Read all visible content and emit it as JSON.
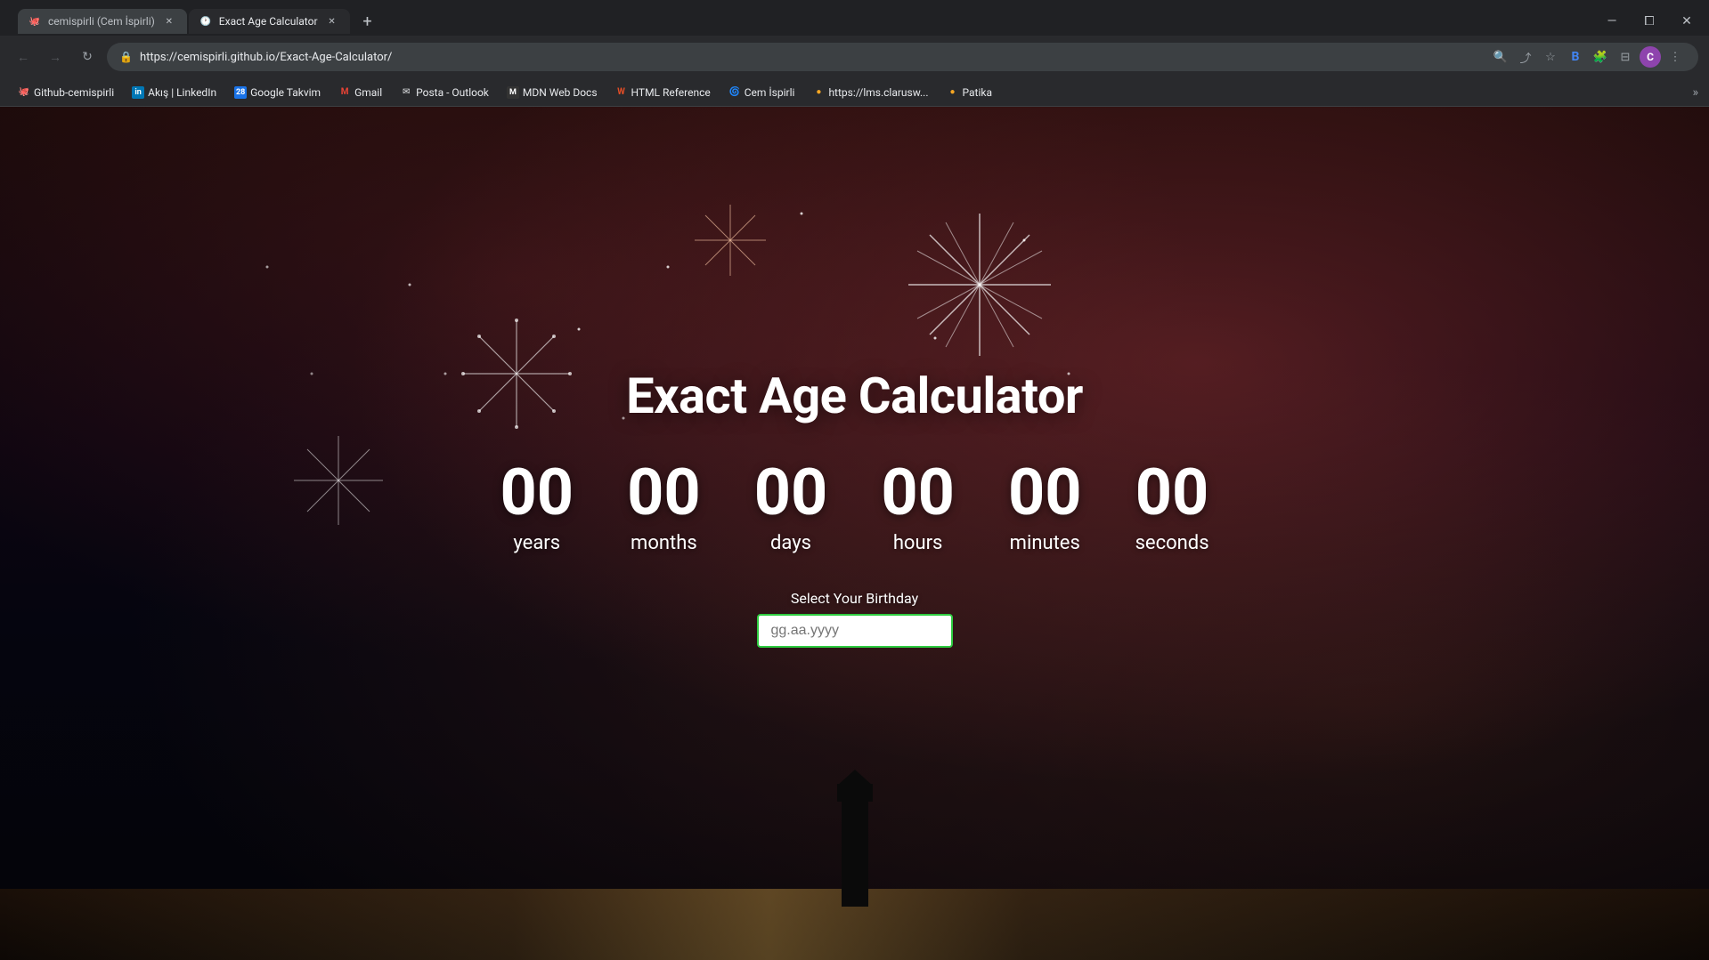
{
  "browser": {
    "tabs": [
      {
        "id": "tab-github",
        "title": "cemispirli (Cem İspirli)",
        "active": false,
        "favicon": "🐙"
      },
      {
        "id": "tab-calculator",
        "title": "Exact Age Calculator",
        "active": true,
        "favicon": "🕐"
      }
    ],
    "new_tab_icon": "+",
    "window_controls": {
      "minimize": "—",
      "maximize": "⧠",
      "close": "✕"
    },
    "nav": {
      "back": "←",
      "forward": "→",
      "refresh": "↻",
      "url": "https://cemispirli.github.io/Exact-Age-Calculator/",
      "lock_icon": "🔒"
    },
    "nav_icons": {
      "search": "🔍",
      "share": "⬆",
      "bookmark": "☆",
      "extensions_b": "B",
      "extensions": "🧩",
      "sidebar": "⊟",
      "more": "⋮"
    },
    "profile": "C",
    "bookmarks": [
      {
        "id": "bm-github",
        "label": "Github-cemispirli",
        "favicon": "🐙"
      },
      {
        "id": "bm-linkedin",
        "label": "Akış | LinkedIn",
        "favicon": "in"
      },
      {
        "id": "bm-google-cal",
        "label": "Google Takvim",
        "favicon": "28"
      },
      {
        "id": "bm-gmail",
        "label": "Gmail",
        "favicon": "M"
      },
      {
        "id": "bm-outlook",
        "label": "Posta - Outlook",
        "favicon": "✉"
      },
      {
        "id": "bm-mdn",
        "label": "MDN Web Docs",
        "favicon": "M"
      },
      {
        "id": "bm-html-ref",
        "label": "HTML Reference",
        "favicon": "W"
      },
      {
        "id": "bm-cem",
        "label": "Cem İspirli",
        "favicon": "🌀"
      },
      {
        "id": "bm-lms",
        "label": "https://lms.clarusw...",
        "favicon": "🟡"
      },
      {
        "id": "bm-patika",
        "label": "Patika",
        "favicon": "🟡"
      }
    ],
    "bookmarks_more": "»"
  },
  "app": {
    "title": "Exact Age Calculator",
    "counters": [
      {
        "id": "years",
        "value": "00",
        "label": "years"
      },
      {
        "id": "months",
        "value": "00",
        "label": "months"
      },
      {
        "id": "days",
        "value": "00",
        "label": "days"
      },
      {
        "id": "hours",
        "value": "00",
        "label": "hours"
      },
      {
        "id": "minutes",
        "value": "00",
        "label": "minutes"
      },
      {
        "id": "seconds",
        "value": "00",
        "label": "seconds"
      }
    ],
    "birthday_label": "Select Your Birthday",
    "birthday_placeholder": "gg.aa.yyyy"
  },
  "colors": {
    "accent_green": "#2ecc40",
    "profile_bg": "#8e44ad",
    "tab_active_bg": "#292a2d",
    "tab_inactive_bg": "#3c4043",
    "nav_bg": "#292a2d",
    "chrome_bg": "#202124"
  }
}
